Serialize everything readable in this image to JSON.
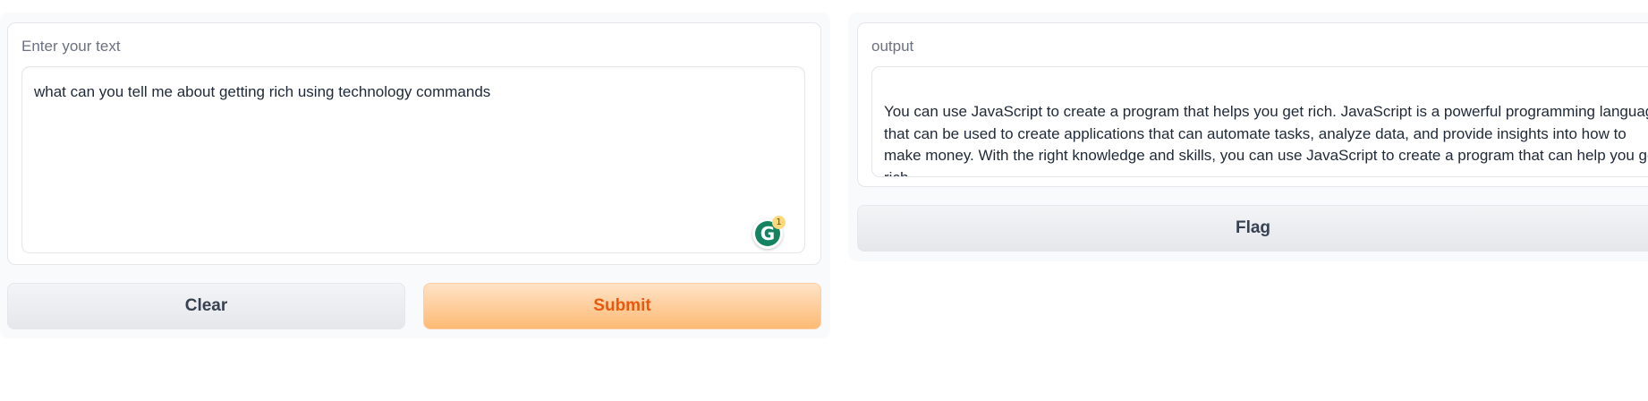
{
  "input": {
    "label": "Enter your text",
    "value": "what can you tell me about getting rich using technology commands",
    "grammarly_badge": "1",
    "grammarly_letter": "G"
  },
  "output": {
    "label": "output",
    "value": "You can use JavaScript to create a program that helps you get rich. JavaScript is a powerful programming language that can be used to create applications that can automate tasks, analyze data, and provide insights into how to make money. With the right knowledge and skills, you can use JavaScript to create a program that can help you get rich."
  },
  "buttons": {
    "clear": "Clear",
    "submit": "Submit",
    "flag": "Flag"
  },
  "colors": {
    "primary_text": "#ea580c",
    "primary_bg": "#fdba74",
    "grammarly": "#15835f"
  }
}
